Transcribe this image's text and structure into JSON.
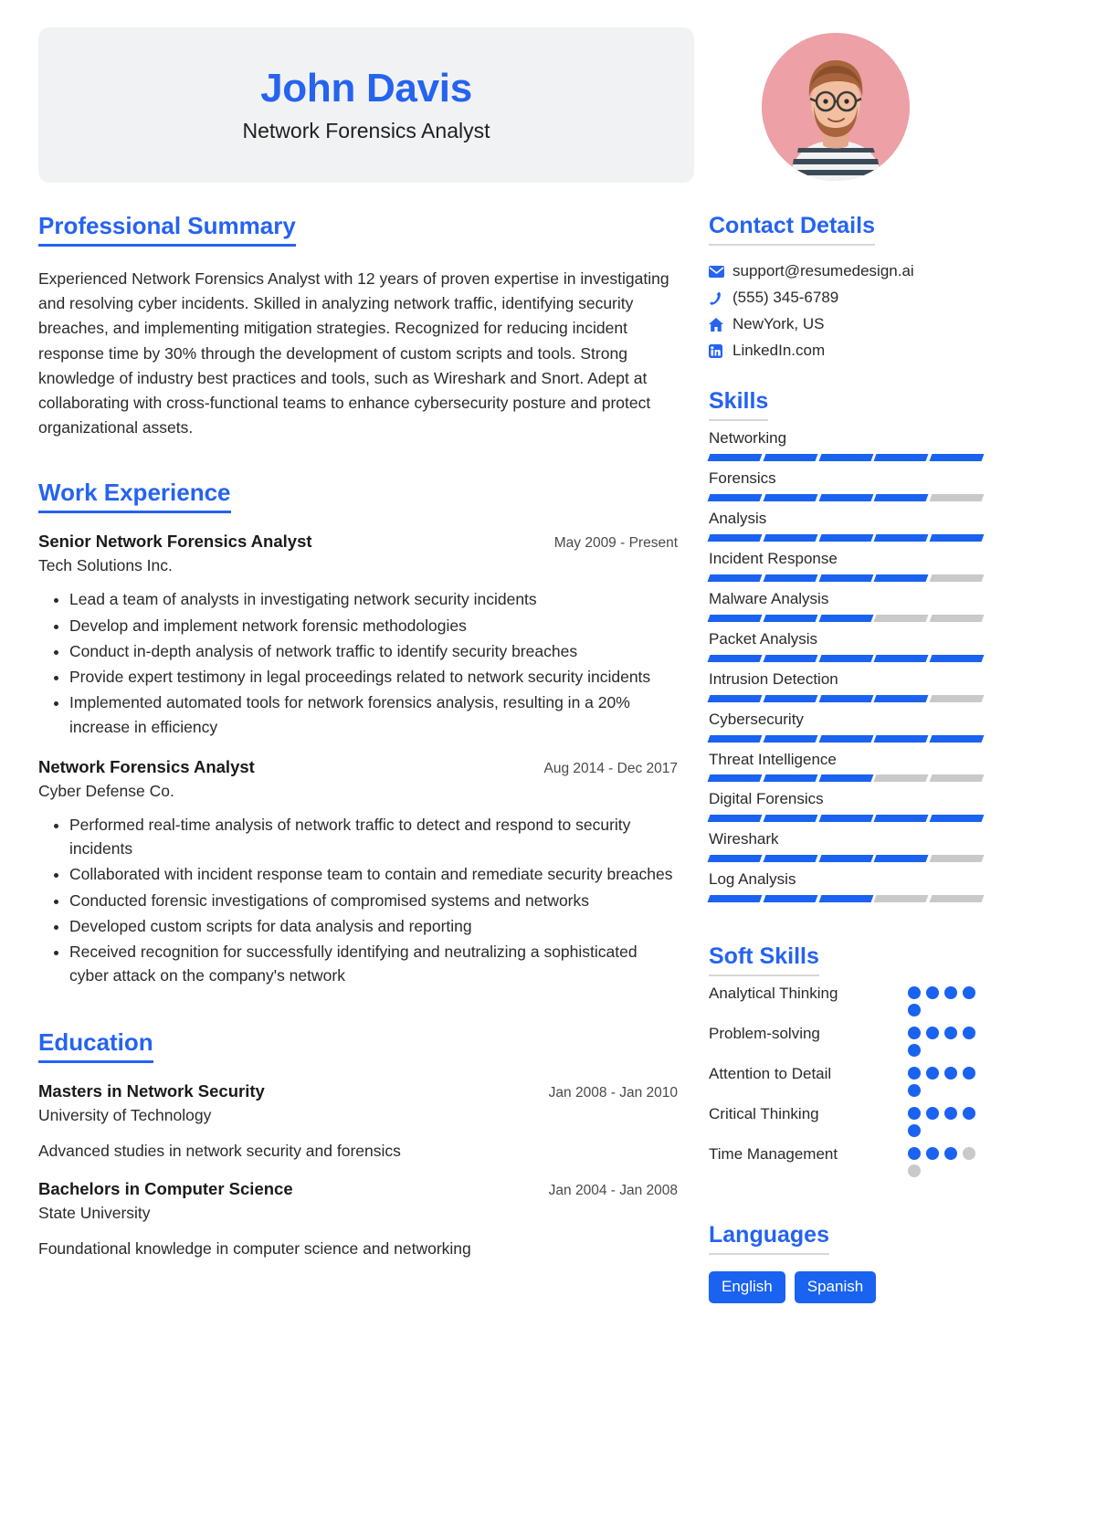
{
  "accent_color": "#2563f0",
  "bar_on_color": "#1a62f0",
  "bar_off_color": "#c9c9c9",
  "header": {
    "name": "John Davis",
    "job_title": "Network Forensics Analyst",
    "avatar_name": "profile-photo"
  },
  "summary": {
    "heading": "Professional Summary",
    "text": "Experienced Network Forensics Analyst with 12 years of proven expertise in investigating and resolving cyber incidents. Skilled in analyzing network traffic, identifying security breaches, and implementing mitigation strategies. Recognized for reducing incident response time by 30% through the development of custom scripts and tools. Strong knowledge of industry best practices and tools, such as Wireshark and Snort. Adept at collaborating with cross-functional teams to enhance cybersecurity posture and protect organizational assets."
  },
  "work": {
    "heading": "Work Experience",
    "jobs": [
      {
        "role": "Senior Network Forensics Analyst",
        "dates": "May 2009 - Present",
        "company": "Tech Solutions Inc.",
        "bullets": [
          "Lead a team of analysts in investigating network security incidents",
          "Develop and implement network forensic methodologies",
          "Conduct in-depth analysis of network traffic to identify security breaches",
          "Provide expert testimony in legal proceedings related to network security incidents",
          "Implemented automated tools for network forensics analysis, resulting in a 20% increase in efficiency"
        ]
      },
      {
        "role": "Network Forensics Analyst",
        "dates": "Aug 2014 - Dec 2017",
        "company": "Cyber Defense Co.",
        "bullets": [
          "Performed real-time analysis of network traffic to detect and respond to security incidents",
          "Collaborated with incident response team to contain and remediate security breaches",
          "Conducted forensic investigations of compromised systems and networks",
          "Developed custom scripts for data analysis and reporting",
          "Received recognition for successfully identifying and neutralizing a sophisticated cyber attack on the company's network"
        ]
      }
    ]
  },
  "education": {
    "heading": "Education",
    "entries": [
      {
        "degree": "Masters in Network Security",
        "dates": "Jan 2008 - Jan 2010",
        "school": "University of Technology",
        "description": "Advanced studies in network security and forensics"
      },
      {
        "degree": "Bachelors in Computer Science",
        "dates": "Jan 2004 - Jan 2008",
        "school": "State University",
        "description": "Foundational knowledge in computer science and networking"
      }
    ]
  },
  "contact": {
    "heading": "Contact Details",
    "items": [
      {
        "icon": "envelope-icon",
        "value": "support@resumedesign.ai"
      },
      {
        "icon": "phone-icon",
        "value": "(555) 345-6789"
      },
      {
        "icon": "home-icon",
        "value": "NewYork, US"
      },
      {
        "icon": "linkedin-icon",
        "value": "LinkedIn.com"
      }
    ]
  },
  "skills": {
    "heading": "Skills",
    "max": 5,
    "items": [
      {
        "name": "Networking",
        "level": 5
      },
      {
        "name": "Forensics",
        "level": 4
      },
      {
        "name": "Analysis",
        "level": 5
      },
      {
        "name": "Incident Response",
        "level": 4
      },
      {
        "name": "Malware Analysis",
        "level": 3
      },
      {
        "name": "Packet Analysis",
        "level": 5
      },
      {
        "name": "Intrusion Detection",
        "level": 4
      },
      {
        "name": "Cybersecurity",
        "level": 5
      },
      {
        "name": "Threat Intelligence",
        "level": 3
      },
      {
        "name": "Digital Forensics",
        "level": 5
      },
      {
        "name": "Wireshark",
        "level": 4
      },
      {
        "name": "Log Analysis",
        "level": 3
      }
    ]
  },
  "soft_skills": {
    "heading": "Soft Skills",
    "max": 5,
    "items": [
      {
        "name": "Analytical Thinking",
        "level": 5
      },
      {
        "name": "Problem-solving",
        "level": 5
      },
      {
        "name": "Attention to Detail",
        "level": 5
      },
      {
        "name": "Critical Thinking",
        "level": 5
      },
      {
        "name": "Time Management",
        "level": 3
      }
    ]
  },
  "languages": {
    "heading": "Languages",
    "items": [
      "English",
      "Spanish"
    ]
  }
}
